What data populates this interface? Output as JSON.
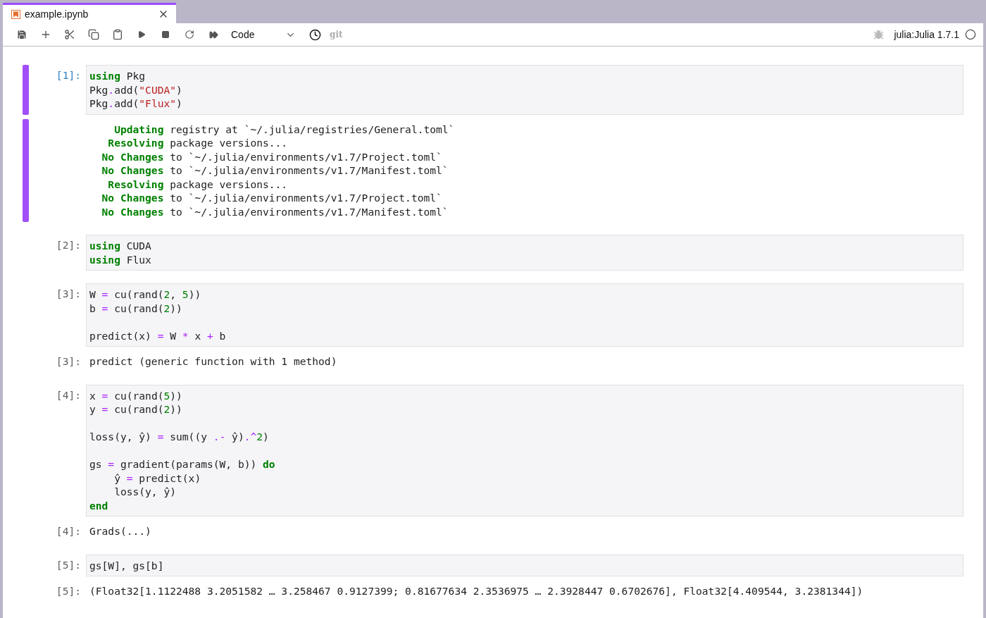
{
  "tabs": [
    {
      "label": "example.ipynb",
      "selected": true
    }
  ],
  "toolbar": {
    "cell_type": "Code",
    "git": "git",
    "kernel": "julia:Julia 1.7.1"
  },
  "cells": [
    {
      "prompt": "[1]:",
      "selected": true,
      "blocks": [
        [
          [
            {
              "kind": "kw",
              "text": "using"
            },
            {
              "kind": "p",
              "text": " Pkg"
            }
          ],
          [
            {
              "kind": "member",
              "text": "Pkg.add("
            },
            {
              "kind": "str",
              "text": "\"CUDA\""
            },
            {
              "kind": "p",
              "text": ")"
            }
          ],
          [
            {
              "kind": "member",
              "text": "Pkg.add("
            },
            {
              "kind": "str",
              "text": "\"Flux\""
            },
            {
              "kind": "p",
              "text": ")"
            }
          ]
        ]
      ],
      "output": {
        "lines": [
          [
            {
              "kind": "kw",
              "text": "    Updating"
            },
            {
              "kind": "p",
              "text": " registry at `~/.julia/registries/General.toml`"
            }
          ],
          [
            {
              "kind": "kw",
              "text": "   Resolving"
            },
            {
              "kind": "p",
              "text": " package versions..."
            }
          ],
          [
            {
              "kind": "kw",
              "text": "  No Changes"
            },
            {
              "kind": "p",
              "text": " to `~/.julia/environments/v1.7/Project.toml`"
            }
          ],
          [
            {
              "kind": "kw",
              "text": "  No Changes"
            },
            {
              "kind": "p",
              "text": " to `~/.julia/environments/v1.7/Manifest.toml`"
            }
          ],
          [
            {
              "kind": "kw",
              "text": "   Resolving"
            },
            {
              "kind": "p",
              "text": " package versions..."
            }
          ],
          [
            {
              "kind": "kw",
              "text": "  No Changes"
            },
            {
              "kind": "p",
              "text": " to `~/.julia/environments/v1.7/Project.toml`"
            }
          ],
          [
            {
              "kind": "kw",
              "text": "  No Changes"
            },
            {
              "kind": "p",
              "text": " to `~/.julia/environments/v1.7/Manifest.toml`"
            }
          ]
        ]
      }
    },
    {
      "prompt": "[2]:",
      "selected": false,
      "blocks": [
        [
          [
            {
              "kind": "kw",
              "text": "using"
            },
            {
              "kind": "p",
              "text": " CUDA"
            }
          ],
          [
            {
              "kind": "kw",
              "text": "using"
            },
            {
              "kind": "p",
              "text": " Flux"
            }
          ]
        ]
      ]
    },
    {
      "prompt": "[3]:",
      "selected": false,
      "blocks": [
        [
          [
            {
              "kind": "p",
              "text": "W "
            },
            {
              "kind": "op",
              "text": "="
            },
            {
              "kind": "p",
              "text": " cu(rand("
            },
            {
              "kind": "num",
              "text": "2"
            },
            {
              "kind": "p",
              "text": ", "
            },
            {
              "kind": "num",
              "text": "5"
            },
            {
              "kind": "p",
              "text": "))"
            }
          ],
          [
            {
              "kind": "p",
              "text": "b "
            },
            {
              "kind": "op",
              "text": "="
            },
            {
              "kind": "p",
              "text": " cu(rand("
            },
            {
              "kind": "num",
              "text": "2"
            },
            {
              "kind": "p",
              "text": "))"
            }
          ]
        ],
        [
          [
            {
              "kind": "p",
              "text": "predict(x) "
            },
            {
              "kind": "op",
              "text": "="
            },
            {
              "kind": "p",
              "text": " W "
            },
            {
              "kind": "op",
              "text": "*"
            },
            {
              "kind": "p",
              "text": " x "
            },
            {
              "kind": "op",
              "text": "+"
            },
            {
              "kind": "p",
              "text": " b"
            }
          ]
        ]
      ],
      "output": {
        "prompt": "[3]:",
        "lines": [
          [
            {
              "kind": "p",
              "text": "predict (generic function with 1 method)"
            }
          ]
        ]
      }
    },
    {
      "prompt": "[4]:",
      "selected": false,
      "blocks": [
        [
          [
            {
              "kind": "p",
              "text": "x "
            },
            {
              "kind": "op",
              "text": "="
            },
            {
              "kind": "p",
              "text": " cu(rand("
            },
            {
              "kind": "num",
              "text": "5"
            },
            {
              "kind": "p",
              "text": "))"
            }
          ],
          [
            {
              "kind": "p",
              "text": "y "
            },
            {
              "kind": "op",
              "text": "="
            },
            {
              "kind": "p",
              "text": " cu(rand("
            },
            {
              "kind": "num",
              "text": "2"
            },
            {
              "kind": "p",
              "text": "))"
            }
          ]
        ],
        [
          [
            {
              "kind": "p",
              "text": "loss(y, ŷ) "
            },
            {
              "kind": "op",
              "text": "="
            },
            {
              "kind": "p",
              "text": " sum((y "
            },
            {
              "kind": "op",
              "text": ".-"
            },
            {
              "kind": "p",
              "text": " ŷ)"
            },
            {
              "kind": "op",
              "text": ".^"
            },
            {
              "kind": "num",
              "text": "2"
            },
            {
              "kind": "p",
              "text": ")"
            }
          ]
        ],
        [
          [
            {
              "kind": "p",
              "text": "gs "
            },
            {
              "kind": "op",
              "text": "="
            },
            {
              "kind": "p",
              "text": " gradient(params(W, b)) "
            },
            {
              "kind": "kw",
              "text": "do"
            }
          ],
          [
            {
              "kind": "p",
              "text": "    ŷ "
            },
            {
              "kind": "op",
              "text": "="
            },
            {
              "kind": "p",
              "text": " predict(x)"
            }
          ],
          [
            {
              "kind": "p",
              "text": "    loss(y, ŷ)"
            }
          ],
          [
            {
              "kind": "kw",
              "text": "end"
            }
          ]
        ]
      ],
      "output": {
        "prompt": "[4]:",
        "lines": [
          [
            {
              "kind": "p",
              "text": "Grads(...)"
            }
          ]
        ]
      }
    },
    {
      "prompt": "[5]:",
      "selected": false,
      "blocks": [
        [
          [
            {
              "kind": "p",
              "text": "gs[W], gs[b]"
            }
          ]
        ]
      ],
      "output": {
        "prompt": "[5]:",
        "lines": [
          [
            {
              "kind": "p",
              "text": "(Float32[1.1122488 3.2051582 … 3.258467 0.9127399; 0.81677634 2.3536975 … 2.3928447 0.6702676], Float32[4.409544, 3.2381344])"
            }
          ]
        ]
      }
    }
  ]
}
